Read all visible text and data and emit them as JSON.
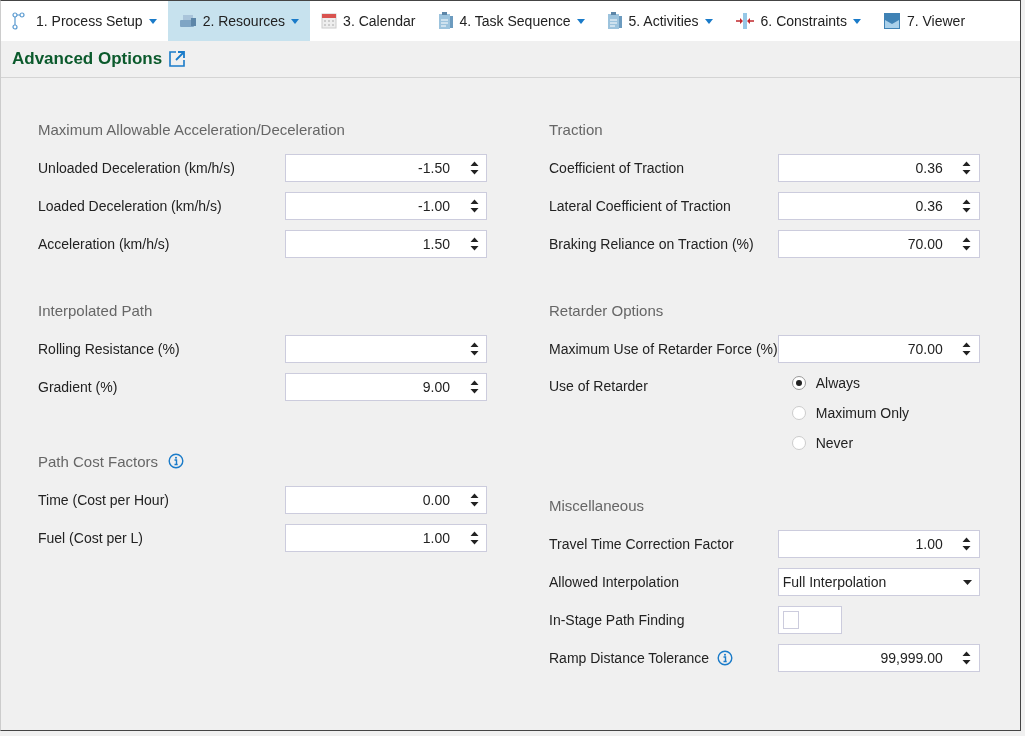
{
  "tabs": [
    {
      "label": "1. Process Setup",
      "selected": false,
      "dropdown": true
    },
    {
      "label": "2. Resources",
      "selected": true,
      "dropdown": true
    },
    {
      "label": "3. Calendar",
      "selected": false,
      "dropdown": false
    },
    {
      "label": "4. Task Sequence",
      "selected": false,
      "dropdown": true
    },
    {
      "label": "5. Activities",
      "selected": false,
      "dropdown": true
    },
    {
      "label": "6. Constraints",
      "selected": false,
      "dropdown": true
    },
    {
      "label": "7. Viewer",
      "selected": false,
      "dropdown": false
    }
  ],
  "header": {
    "title": "Advanced Options"
  },
  "columns": [
    {
      "sections": [
        {
          "title": "Maximum Allowable Acceleration/Deceleration",
          "rows": [
            {
              "kind": "number",
              "label": "Unloaded Deceleration (km/h/s)",
              "value": "-1.50"
            },
            {
              "kind": "number",
              "label": "Loaded Deceleration (km/h/s)",
              "value": "-1.00"
            },
            {
              "kind": "number",
              "label": "Acceleration (km/h/s)",
              "value": "1.50"
            }
          ]
        },
        {
          "title": "Interpolated Path",
          "rows": [
            {
              "kind": "number",
              "label": "Rolling Resistance (%)"
            },
            {
              "kind": "number",
              "label": "Gradient (%)",
              "value": "9.00"
            }
          ]
        },
        {
          "title": "Path Cost Factors",
          "info": true,
          "rows": [
            {
              "kind": "number",
              "label": "Time (Cost per Hour)",
              "value": "0.00"
            },
            {
              "kind": "number",
              "label": "Fuel (Cost per L)",
              "value": "1.00"
            }
          ]
        }
      ]
    },
    {
      "sections": [
        {
          "title": "Traction",
          "rows": [
            {
              "kind": "number",
              "label": "Coefficient of Traction",
              "value": "0.36"
            },
            {
              "kind": "number",
              "label": "Lateral Coefficient of Traction",
              "value": "0.36"
            },
            {
              "kind": "number",
              "label": "Braking Reliance on Traction (%)",
              "value": "70.00"
            }
          ]
        },
        {
          "title": "Retarder Options",
          "rows": [
            {
              "kind": "number",
              "label": "Maximum Use of Retarder Force (%)",
              "value": "70.00"
            },
            {
              "kind": "radio",
              "label": "Use of Retarder",
              "options": [
                {
                  "label": "Always",
                  "selected": true
                },
                {
                  "label": "Maximum Only",
                  "selected": false
                },
                {
                  "label": "Never",
                  "selected": false
                }
              ]
            }
          ]
        },
        {
          "title": "Miscellaneous",
          "rows": [
            {
              "kind": "number",
              "label": "Travel Time Correction Factor",
              "value": "1.00"
            },
            {
              "kind": "select",
              "label": "Allowed Interpolation",
              "value": "Full Interpolation"
            },
            {
              "kind": "checkbox",
              "label": "In-Stage Path Finding",
              "checked": false
            },
            {
              "kind": "number",
              "label": "Ramp Distance Tolerance",
              "info": true,
              "value": "99,999.00"
            }
          ]
        }
      ]
    }
  ]
}
